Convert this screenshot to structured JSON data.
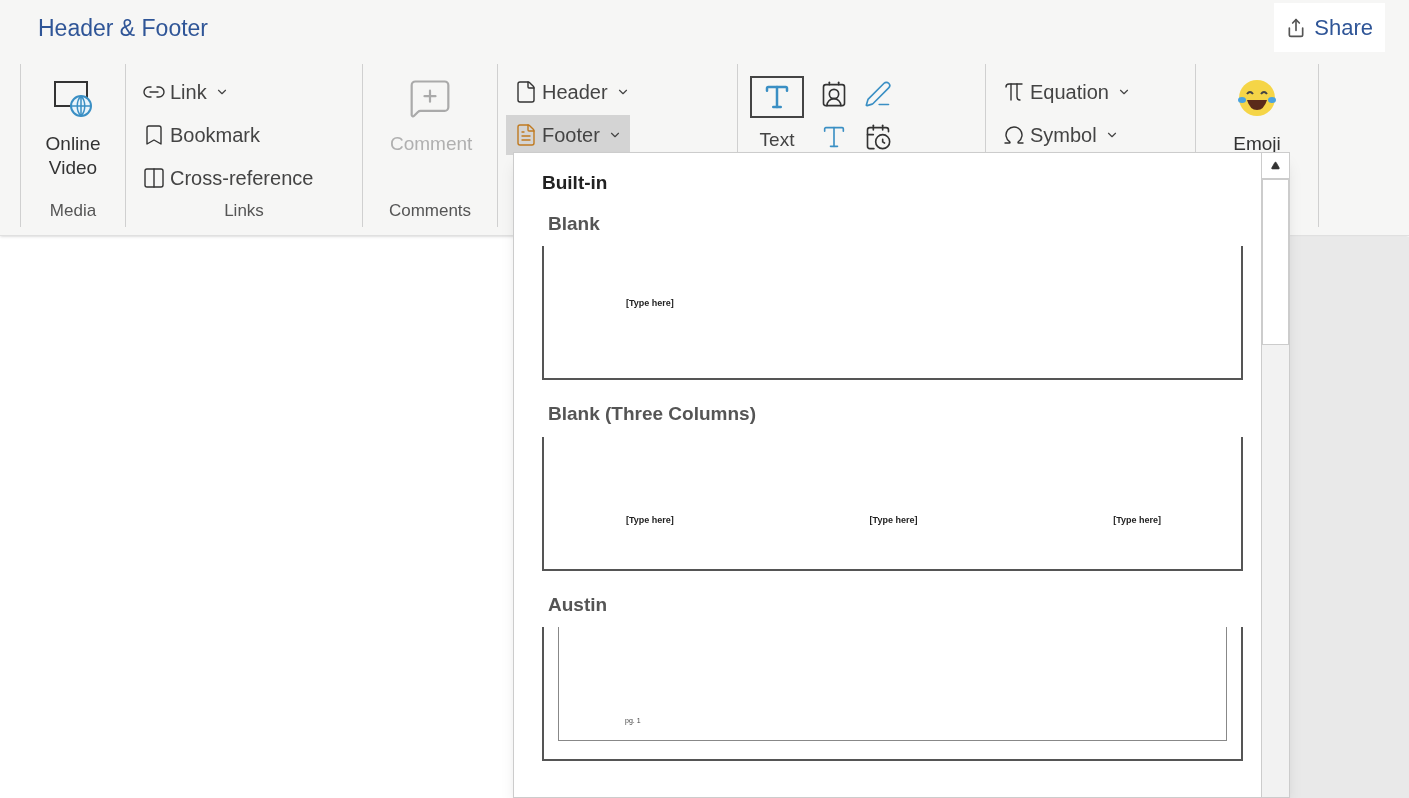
{
  "tab_title": "Header & Footer",
  "share": "Share",
  "groups": [
    {
      "kind": "large",
      "label": "Media",
      "items": [
        {
          "text": "Online Video",
          "disabled": false
        }
      ]
    },
    {
      "kind": "small",
      "label": "Links",
      "items": [
        {
          "text": "Link",
          "dropdown": true,
          "selected": false
        },
        {
          "text": "Bookmark",
          "dropdown": false,
          "selected": false
        },
        {
          "text": "Cross-reference",
          "dropdown": false,
          "selected": false
        }
      ]
    },
    {
      "kind": "large",
      "label": "Comments",
      "items": [
        {
          "text": "Comment",
          "disabled": true
        }
      ]
    },
    {
      "kind": "small",
      "items": [
        {
          "text": "Header",
          "dropdown": true,
          "selected": false
        },
        {
          "text": "Footer",
          "dropdown": true,
          "selected": true
        }
      ]
    },
    {
      "kind": "text",
      "items": [
        {
          "text": "Text"
        }
      ]
    },
    {
      "kind": "small",
      "items": [
        {
          "text": "Equation",
          "dropdown": true,
          "selected": false
        },
        {
          "text": "Symbol",
          "dropdown": true,
          "selected": false
        }
      ]
    },
    {
      "kind": "large",
      "items": [
        {
          "text": "Emoji",
          "disabled": false
        }
      ]
    }
  ],
  "footer_menu": {
    "heading": "Built-in",
    "sections": [
      {
        "kind": "plain",
        "name": "Blank",
        "previews": [
          "[Type here]"
        ]
      },
      {
        "kind": "columns",
        "name": "Blank (Three Columns)",
        "previews": [
          "[Type here]",
          "[Type here]",
          "[Type here]"
        ]
      },
      {
        "kind": "framed",
        "name": "Austin",
        "previews": [
          "pg. 1"
        ]
      }
    ]
  }
}
